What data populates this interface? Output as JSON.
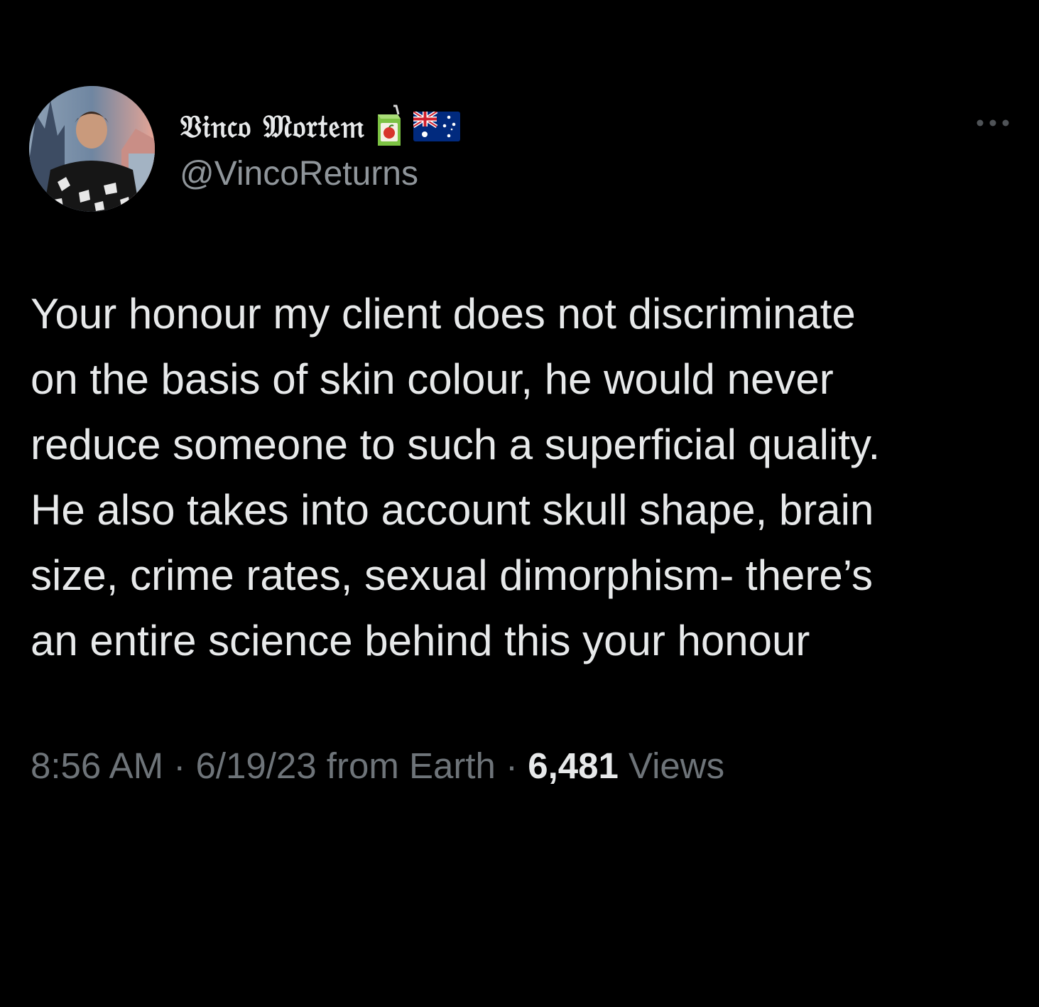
{
  "tweet": {
    "author": {
      "display_name": "𝔙𝔦𝔫𝔠𝔬 𝔐𝔬𝔯𝔱𝔢𝔪",
      "handle": "@VincoReturns",
      "avatar_icon": "profile-photo",
      "name_emojis": [
        "juice-box-icon",
        "australia-flag-icon"
      ]
    },
    "more_icon": "ellipsis-icon",
    "text_lines": [
      "Your honour my client does not discriminate",
      "on the basis of skin colour, he would never",
      "reduce someone to such a superficial quality.",
      "He also takes into account skull shape, brain",
      "size, crime rates, sexual dimorphism- there’s",
      "an entire science behind this your honour"
    ],
    "meta": {
      "time": "8:56 AM",
      "separator": " · ",
      "date": "6/19/23",
      "source": "from Earth",
      "views_count": "6,481",
      "views_label": "Views"
    }
  },
  "colors": {
    "background": "#000000",
    "primary_text": "#e7e9ea",
    "secondary_text": "#8f959a",
    "meta_text": "#6e7479"
  }
}
